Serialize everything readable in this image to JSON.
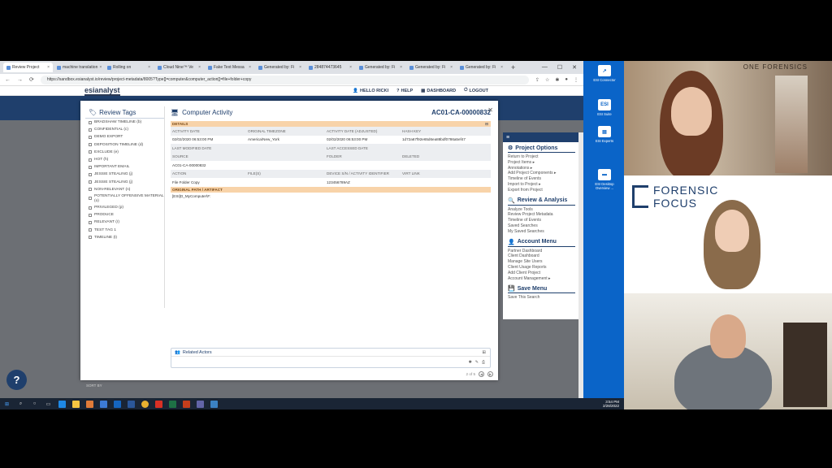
{
  "browser": {
    "tabs": [
      {
        "label": "Review Project",
        "active": true
      },
      {
        "label": "machine translation",
        "active": false
      },
      {
        "label": "Rolling on",
        "active": false
      },
      {
        "label": "Cloud Nine™ Ve",
        "active": false
      },
      {
        "label": "Fake Text Messa",
        "active": false
      },
      {
        "label": "Generated by: Fi",
        "active": false
      },
      {
        "label": "284874473645",
        "active": false
      },
      {
        "label": "Generated by: Fi",
        "active": false
      },
      {
        "label": "Generated by: Fi",
        "active": false
      },
      {
        "label": "Generated by: Fi",
        "active": false
      }
    ],
    "url": "https://sandbox.esianalyst.io/review/project-metadata/8005?Type[]=computer&computer_action[]=file+folder+copy"
  },
  "app": {
    "logo": "esianalyst",
    "nav": {
      "hello": "HELLO RICKI",
      "help": "HELP",
      "dashboard": "DASHBOARD",
      "logout": "LOGOUT"
    },
    "sort_by": "SORT BY"
  },
  "tags_panel": {
    "title": "Review Tags",
    "tags": [
      "BRADSHAW TIMELINE (b)",
      "CONFIDENTIAL (c)",
      "DEMO EXPORT",
      "DEPOSITION TIMELINE (d)",
      "EXCLUDE (e)",
      "HOT (h)",
      "IMPORTANT EMAIL",
      "JESSIE STEALING (j)",
      "JESSIE STEALING (j)",
      "NON-RELEVANT (n)",
      "POTENTIALLY OFFENSIVE MATERIAL (o)",
      "PRIVILEGED (p)",
      "PRODUCE",
      "RELEVANT (r)",
      "TEST TAG 1",
      "TIMELINE (t)"
    ]
  },
  "activity": {
    "title": "Computer Activity",
    "id": "AC01-CA-00000832",
    "details_label": "DETAILS",
    "headers1": [
      "ACTIVITY DATE",
      "ORIGINAL TIMEZONE",
      "ACTIVITY DATE (ADJUSTED)",
      "HASH KEY"
    ],
    "values1": [
      "02/02/2020 06:53:00 PM",
      "America/New_York",
      "02/02/2020 06:53:00 PM",
      "1d72a67f92e65d6ea88bdf0786a5ef47"
    ],
    "headers2": [
      "LAST MODIFIED DATE",
      "",
      "LAST ACCESSED DATE",
      ""
    ],
    "headers3": [
      "SOURCE",
      "",
      "FOLDER",
      "DELETED"
    ],
    "values3": [
      "AC01-CA-00000832",
      "",
      "",
      ""
    ],
    "headers4": [
      "ACTION",
      "FILE(S)",
      "DEVICE S/N / ACTIVITY IDENTIFIER",
      "VIRT LINK"
    ],
    "values4": [
      "File Folder Copy",
      "",
      "123456789AZ",
      ""
    ],
    "artifact_label": "ORIGINAL PATH / ARTIFACT",
    "artifact_value": "[ESI]D_MyComputer\\F:",
    "related_actors": "Related Actors",
    "pager": "2 of 5"
  },
  "right_nav": {
    "sections": [
      {
        "title": "Project Options",
        "items": [
          "Return to Project",
          "Project Items ▸",
          "Annotations ▸",
          "Add Project Components ▸",
          "Timeline of Events",
          "Import to Project ▸",
          "Export from Project"
        ]
      },
      {
        "title": "Review & Analysis",
        "items": [
          "Analyze Tools",
          "Review Project Metadata",
          "Timeline of Events",
          "Saved Searches",
          "My Saved Searches"
        ]
      },
      {
        "title": "Account Menu",
        "items": [
          "Partner Dashboard",
          "Client Dashboard",
          "Manage Site Users",
          "Client Usage Reports",
          "Add Client Project",
          "Account Management ▸"
        ]
      },
      {
        "title": "Save Menu",
        "items": [
          "Save This Search"
        ]
      }
    ]
  },
  "desktop": {
    "icons": [
      {
        "label": "ESI Connector",
        "glyph": "↗"
      },
      {
        "label": "ESI Suite",
        "glyph": "ESI"
      },
      {
        "label": "ESI Experts",
        "glyph": "▤"
      },
      {
        "label": "ESI Desktop Overview ...",
        "glyph": "▬"
      }
    ]
  },
  "taskbar": {
    "time": "3:54 PM",
    "date": "2/28/2022"
  },
  "video": {
    "sign": "ONE FORENSICS",
    "logo_line1": "FORENSIC",
    "logo_line2": "FOCUS"
  },
  "colors": {
    "navy": "#1f3f6c",
    "section_orange": "#f8d3a9",
    "desktop_blue": "#0a64c8"
  }
}
